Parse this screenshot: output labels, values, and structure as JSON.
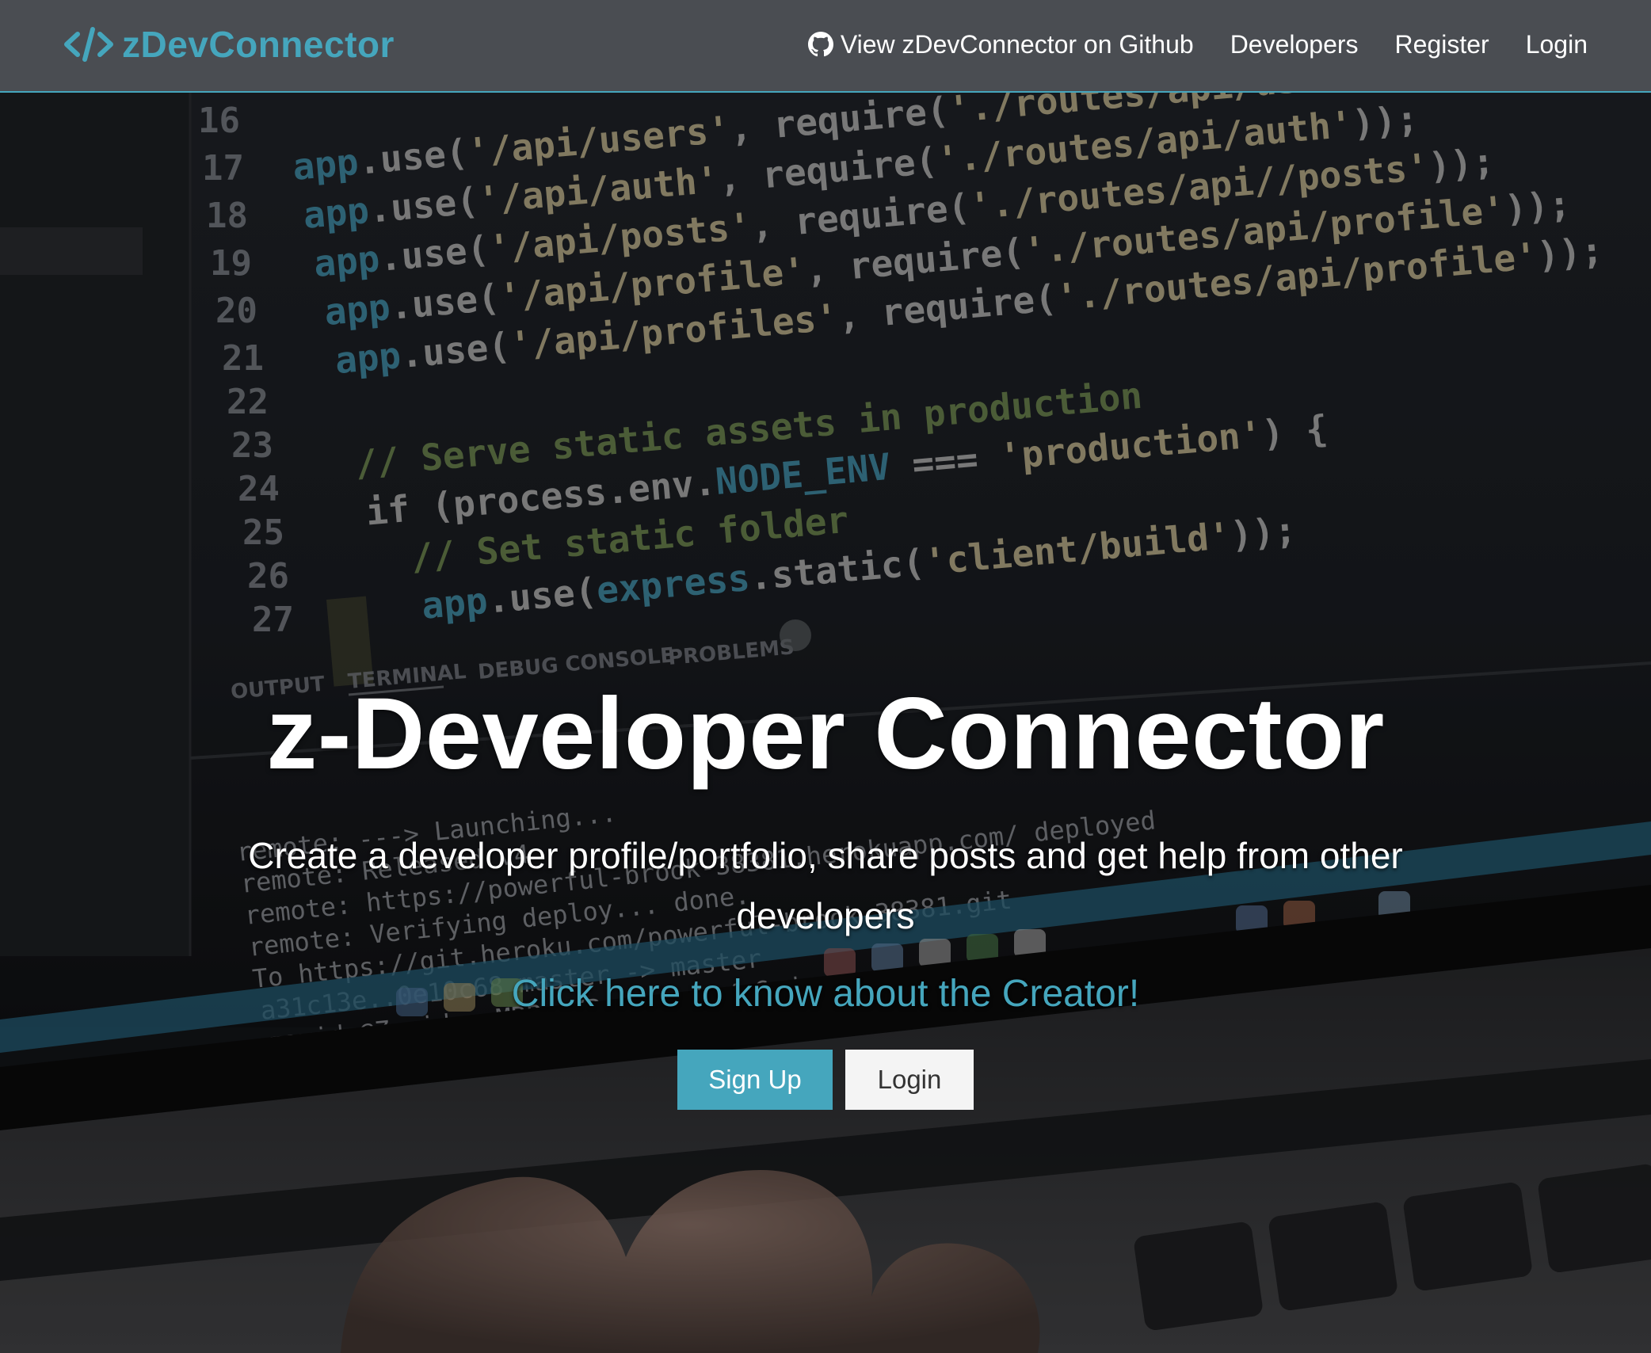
{
  "navbar": {
    "brand": "zDevConnector",
    "brand_icon": "code-icon",
    "links": [
      {
        "label": "View zDevConnector on Github",
        "icon": "github-icon"
      },
      {
        "label": "Developers"
      },
      {
        "label": "Register"
      },
      {
        "label": "Login"
      }
    ]
  },
  "landing": {
    "title": "z-Developer Connector",
    "lead": "Create a developer profile/portfolio, share posts and get help from other developers",
    "creator_link": "Click here to know about the Creator!",
    "buttons": {
      "signup": "Sign Up",
      "login": "Login"
    }
  },
  "colors": {
    "navbar_bg": "#4a4d52",
    "accent": "#45a6bd",
    "button_light": "#f4f4f4",
    "text": "#ffffff"
  }
}
